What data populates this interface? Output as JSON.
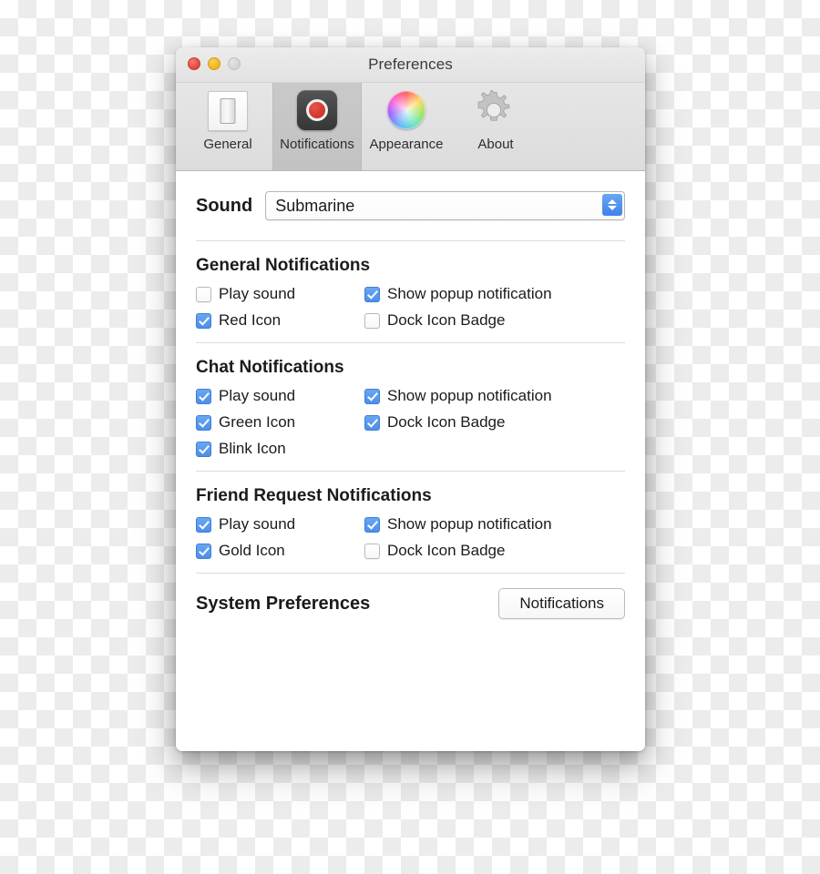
{
  "window": {
    "title": "Preferences",
    "traffic_lights": [
      {
        "name": "close",
        "color": "#e0443b"
      },
      {
        "name": "minimize",
        "color": "#eeb31b"
      },
      {
        "name": "zoom",
        "color": "#d2d2d2"
      }
    ]
  },
  "toolbar": {
    "tabs": [
      {
        "label": "General",
        "icon": "light-switch-icon",
        "selected": false
      },
      {
        "label": "Notifications",
        "icon": "record-dot-icon",
        "selected": true
      },
      {
        "label": "Appearance",
        "icon": "color-wheel-icon",
        "selected": false
      },
      {
        "label": "About",
        "icon": "gear-icon",
        "selected": false
      }
    ]
  },
  "sound": {
    "label": "Sound",
    "selected": "Submarine",
    "stepper_icon": "up-down-chevron-icon",
    "accent_color": "#4c8fea"
  },
  "sections": [
    {
      "title": "General Notifications",
      "rows": [
        [
          {
            "label": "Play sound",
            "checked": false
          },
          {
            "label": "Show popup notification",
            "checked": true
          }
        ],
        [
          {
            "label": "Red Icon",
            "checked": true
          },
          {
            "label": "Dock Icon Badge",
            "checked": false
          }
        ]
      ]
    },
    {
      "title": "Chat Notifications",
      "rows": [
        [
          {
            "label": "Play sound",
            "checked": true
          },
          {
            "label": "Show popup notification",
            "checked": true
          }
        ],
        [
          {
            "label": "Green Icon",
            "checked": true
          },
          {
            "label": "Dock Icon Badge",
            "checked": true
          }
        ],
        [
          {
            "label": "Blink Icon",
            "checked": true
          }
        ]
      ]
    },
    {
      "title": "Friend Request Notifications",
      "rows": [
        [
          {
            "label": "Play sound",
            "checked": true
          },
          {
            "label": "Show popup notification",
            "checked": true
          }
        ],
        [
          {
            "label": "Gold Icon",
            "checked": true
          },
          {
            "label": "Dock Icon Badge",
            "checked": false
          }
        ]
      ]
    }
  ],
  "system_preferences": {
    "label": "System Preferences",
    "button_label": "Notifications"
  }
}
